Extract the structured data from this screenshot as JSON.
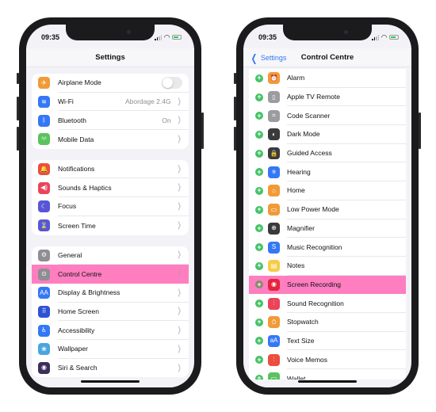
{
  "colors": {
    "highlight": "#fe7ec0",
    "accent_blue": "#3478f6",
    "add_green": "#45c266"
  },
  "left_phone": {
    "status": {
      "time": "09:35"
    },
    "title": "Settings",
    "groups": [
      [
        {
          "label": "Airplane Mode",
          "icon": "airplane-icon",
          "glyph": "✈",
          "color": "#f19a37",
          "toggle": false
        },
        {
          "label": "Wi-Fi",
          "icon": "wifi-icon",
          "glyph": "≋",
          "color": "#3478f6",
          "value": "Abordage 2.4G"
        },
        {
          "label": "Bluetooth",
          "icon": "bluetooth-icon",
          "glyph": "ᛒ",
          "color": "#3478f6",
          "value": "On"
        },
        {
          "label": "Mobile Data",
          "icon": "antenna-icon",
          "glyph": "⁽ᵞ⁾",
          "color": "#5ac25e"
        }
      ],
      [
        {
          "label": "Notifications",
          "icon": "bell-icon",
          "glyph": "🔔",
          "color": "#eb4e3d"
        },
        {
          "label": "Sounds & Haptics",
          "icon": "speaker-icon",
          "glyph": "◀)",
          "color": "#eb445a"
        },
        {
          "label": "Focus",
          "icon": "moon-icon",
          "glyph": "☾",
          "color": "#5856d6"
        },
        {
          "label": "Screen Time",
          "icon": "hourglass-icon",
          "glyph": "⌛",
          "color": "#5856d6"
        }
      ],
      [
        {
          "label": "General",
          "icon": "gear-icon",
          "glyph": "⚙",
          "color": "#8e8e93"
        },
        {
          "label": "Control Centre",
          "icon": "switches-icon",
          "glyph": "⊙",
          "color": "#8e8e93",
          "highlight": true
        },
        {
          "label": "Display & Brightness",
          "icon": "text-size-icon",
          "glyph": "AA",
          "color": "#3478f6"
        },
        {
          "label": "Home Screen",
          "icon": "grid-icon",
          "glyph": "⠿",
          "color": "#2f52d4"
        },
        {
          "label": "Accessibility",
          "icon": "accessibility-icon",
          "glyph": "♿",
          "color": "#3478f6"
        },
        {
          "label": "Wallpaper",
          "icon": "flower-icon",
          "glyph": "❀",
          "color": "#4aa5e0"
        },
        {
          "label": "Siri & Search",
          "icon": "siri-icon",
          "glyph": "◉",
          "color": "#3a2f5b"
        }
      ]
    ]
  },
  "right_phone": {
    "status": {
      "time": "09:35"
    },
    "back_label": "Settings",
    "title": "Control Centre",
    "items": [
      {
        "label": "Alarm",
        "icon": "alarm-icon",
        "glyph": "⏰",
        "color": "#f19a37"
      },
      {
        "label": "Apple TV Remote",
        "icon": "remote-icon",
        "glyph": "▯",
        "color": "#9b9ba0"
      },
      {
        "label": "Code Scanner",
        "icon": "qr-scanner-icon",
        "glyph": "⌗",
        "color": "#9b9ba0"
      },
      {
        "label": "Dark Mode",
        "icon": "dark-mode-icon",
        "glyph": "◐",
        "color": "#3a3a3c"
      },
      {
        "label": "Guided Access",
        "icon": "lock-icon",
        "glyph": "🔒",
        "color": "#3a3a3c"
      },
      {
        "label": "Hearing",
        "icon": "ear-icon",
        "glyph": "ɘ",
        "color": "#3478f6"
      },
      {
        "label": "Home",
        "icon": "house-icon",
        "glyph": "⌂",
        "color": "#f19a37"
      },
      {
        "label": "Low Power Mode",
        "icon": "battery-icon",
        "glyph": "▭",
        "color": "#f19a37"
      },
      {
        "label": "Magnifier",
        "icon": "magnifier-icon",
        "glyph": "⊕",
        "color": "#3a3a3c"
      },
      {
        "label": "Music Recognition",
        "icon": "shazam-icon",
        "glyph": "S",
        "color": "#3478f6"
      },
      {
        "label": "Notes",
        "icon": "notes-icon",
        "glyph": "▤",
        "color": "#f5cd48"
      },
      {
        "label": "Screen Recording",
        "icon": "record-icon",
        "glyph": "◉",
        "color": "#e5243b",
        "highlight": true
      },
      {
        "label": "Sound Recognition",
        "icon": "waveform-icon",
        "glyph": "⫶",
        "color": "#eb445a"
      },
      {
        "label": "Stopwatch",
        "icon": "stopwatch-icon",
        "glyph": "⏱",
        "color": "#f19a37"
      },
      {
        "label": "Text Size",
        "icon": "text-size-icon",
        "glyph": "aA",
        "color": "#3478f6"
      },
      {
        "label": "Voice Memos",
        "icon": "voice-memo-icon",
        "glyph": "⫶",
        "color": "#eb4e3d"
      },
      {
        "label": "Wallet",
        "icon": "wallet-icon",
        "glyph": "▭",
        "color": "#5ac25e"
      }
    ]
  }
}
